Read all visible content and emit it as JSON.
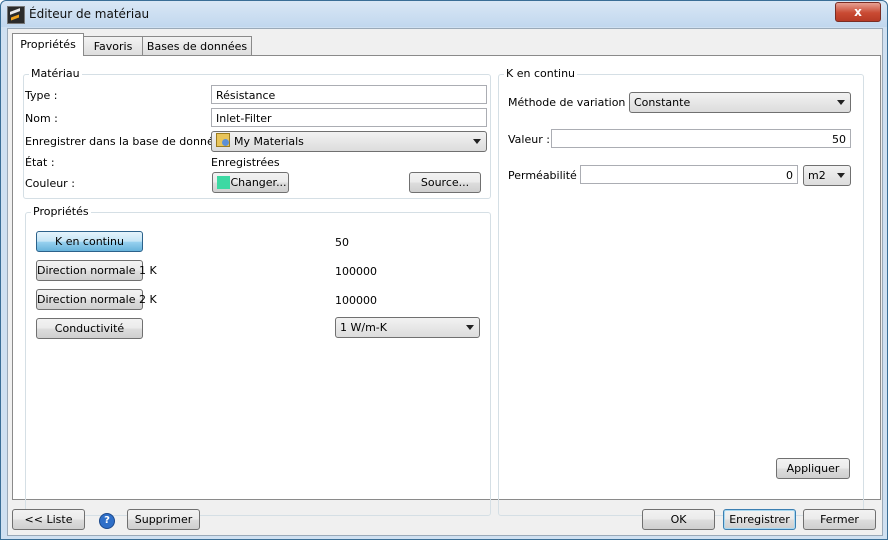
{
  "window": {
    "title": "Éditeur de matériau",
    "close_glyph": "x"
  },
  "tabs": [
    "Propriétés",
    "Favoris",
    "Bases de données"
  ],
  "materiau": {
    "group_title": "Matériau",
    "type_label": "Type :",
    "type_value": "Résistance",
    "nom_label": "Nom :",
    "nom_value": "Inlet-Filter",
    "enregistrer_label": "Enregistrer dans la base de données :",
    "db_value": "My Materials",
    "etat_label": "État :",
    "etat_value": "Enregistrées",
    "couleur_label": "Couleur :",
    "changer_label": "Changer...",
    "source_label": "Source...",
    "swatch_color": "#3dd9a3"
  },
  "proprietes": {
    "group_title": "Propriétés",
    "rows": [
      {
        "label": "K en continu",
        "value": "50"
      },
      {
        "label": "Direction normale 1 K",
        "value": "100000"
      },
      {
        "label": "Direction normale 2 K",
        "value": "100000"
      },
      {
        "label": "Conductivité",
        "value": "1 W/m-K"
      }
    ]
  },
  "kcontinu": {
    "group_title": "K en continu",
    "methode_label": "Méthode de variation :",
    "methode_value": "Constante",
    "valeur_label": "Valeur :",
    "valeur_value": "50",
    "permeabilite_label": "Perméabilité :",
    "permeabilite_value": "0",
    "unit_value": "m2",
    "appliquer_label": "Appliquer"
  },
  "footer": {
    "liste_label": "<< Liste",
    "help_glyph": "?",
    "supprimer_label": "Supprimer",
    "ok_label": "OK",
    "enregistrer_label": "Enregistrer",
    "fermer_label": "Fermer"
  }
}
